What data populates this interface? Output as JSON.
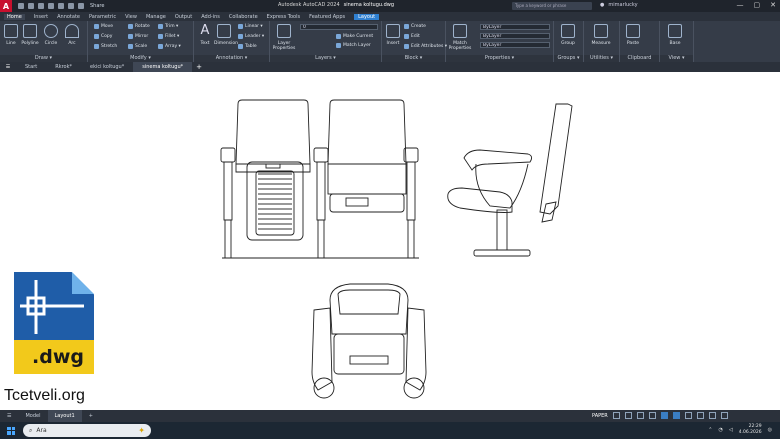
{
  "window": {
    "app_logo": "A",
    "title_app": "Autodesk AutoCAD 2024",
    "title_file": "sinema koltugu.dwg",
    "share_label": "Share",
    "search_placeholder": "Type a keyword or phrase",
    "username": "mimarlucky",
    "controls": [
      "—",
      "▢",
      "✕"
    ]
  },
  "ribbon_tabs": [
    "Home",
    "Insert",
    "Annotate",
    "Parametric",
    "View",
    "Manage",
    "Output",
    "Add-ins",
    "Collaborate",
    "Express Tools",
    "Featured Apps",
    "Layout"
  ],
  "ribbon": {
    "draw": {
      "title": "Draw ▾",
      "tools": [
        "Line",
        "Polyline",
        "Circle",
        "Arc"
      ]
    },
    "modify": {
      "title": "Modify ▾",
      "tools": [
        "Move",
        "Rotate",
        "Trim ▾",
        "Copy",
        "Mirror",
        "Fillet ▾",
        "Stretch",
        "Scale",
        "Array ▾"
      ]
    },
    "annotation": {
      "title": "Annotation ▾",
      "tools": [
        "Text",
        "Dimension",
        "Linear ▾",
        "Leader ▾",
        "Table"
      ]
    },
    "layers": {
      "title": "Layers ▾",
      "tools": [
        "Layer Properties",
        "Make Current",
        "Match Layer"
      ],
      "current_layer": "0"
    },
    "block": {
      "title": "Block ▾",
      "tools": [
        "Insert",
        "Create",
        "Edit",
        "Edit Attributes ▾"
      ]
    },
    "properties": {
      "title": "Properties ▾",
      "tools": [
        "Match Properties"
      ],
      "bylayer": [
        "ByLayer",
        "ByLayer",
        "ByLayer"
      ]
    },
    "groups": {
      "title": "Groups ▾",
      "tools": [
        "Group"
      ]
    },
    "utilities": {
      "title": "Utilities ▾",
      "tools": [
        "Measure"
      ]
    },
    "clipboard": {
      "title": "Clipboard",
      "tools": [
        "Paste"
      ]
    },
    "view": {
      "title": "View ▾",
      "tools": [
        "Base"
      ]
    }
  },
  "doc_tabs": [
    "Start",
    "Rkrok*",
    "ekici koltugu*",
    "sinema koltugu*"
  ],
  "watermark": {
    "ext": ".dwg",
    "site": "Tcetveli.org"
  },
  "status": {
    "layout_tabs": [
      "Model",
      "Layout1"
    ],
    "paper_label": "PAPER"
  },
  "taskbar": {
    "search_label": "Ara",
    "time": "22:29",
    "date": "4.06.2026"
  }
}
